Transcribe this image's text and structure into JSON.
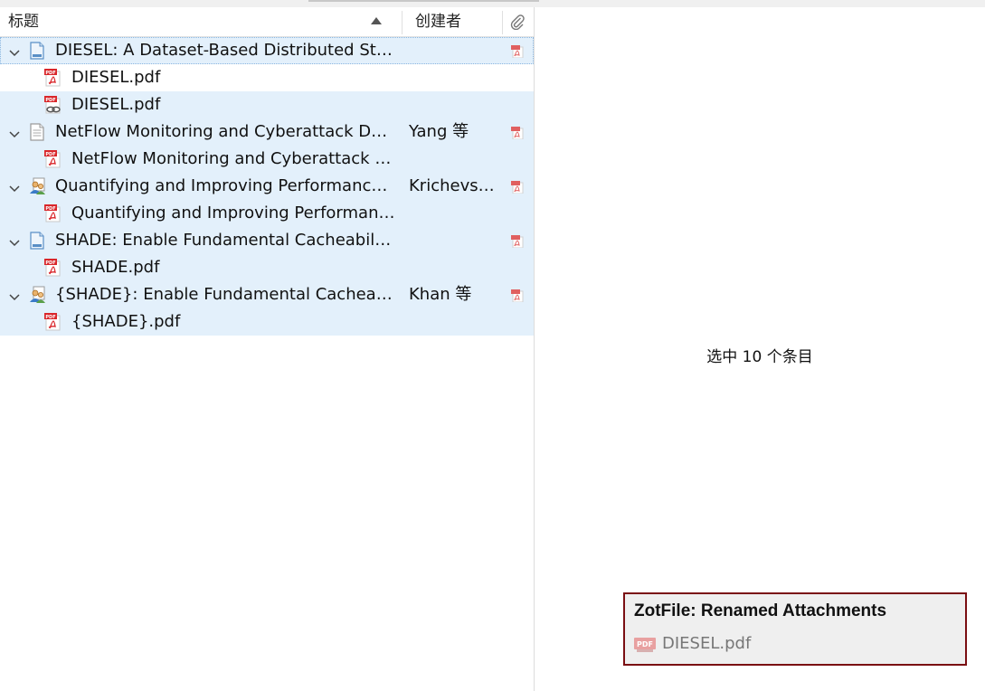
{
  "columns": {
    "title": "标题",
    "creator": "创建者",
    "attachment_icon": "paperclip-icon"
  },
  "items": [
    {
      "kind": "parent",
      "type": "document-icon",
      "title": "DIESEL: A Dataset-Based Distributed Stor…",
      "creator": "",
      "attachment": "pdf-icon"
    },
    {
      "kind": "child",
      "type": "pdf-icon",
      "title": "DIESEL.pdf"
    },
    {
      "kind": "child",
      "type": "linked-pdf-icon",
      "title": "DIESEL.pdf"
    },
    {
      "kind": "parent",
      "type": "note-document-icon",
      "title": "NetFlow Monitoring and Cyberattack Det…",
      "creator": "Yang 等",
      "attachment": "pdf-icon"
    },
    {
      "kind": "child",
      "type": "pdf-icon",
      "title": "NetFlow Monitoring and Cyberattack D…"
    },
    {
      "kind": "parent",
      "type": "conference-paper-icon",
      "title": "Quantifying and Improving Performance …",
      "creator": "Krichevs…",
      "attachment": "pdf-icon"
    },
    {
      "kind": "child",
      "type": "pdf-icon",
      "title": "Quantifying and Improving Performanc…"
    },
    {
      "kind": "parent",
      "type": "document-icon",
      "title": "SHADE: Enable Fundamental Cacheability …",
      "creator": "",
      "attachment": "pdf-icon"
    },
    {
      "kind": "child",
      "type": "pdf-icon",
      "title": "SHADE.pdf"
    },
    {
      "kind": "parent",
      "type": "conference-paper-icon",
      "title": "{SHADE}: Enable Fundamental Cacheabilit…",
      "creator": "Khan 等",
      "attachment": "pdf-icon"
    },
    {
      "kind": "child",
      "type": "pdf-icon",
      "title": "{SHADE}.pdf"
    }
  ],
  "selection_summary": "选中 10 个条目",
  "notification": {
    "title": "ZotFile: Renamed Attachments",
    "file": "DIESEL.pdf",
    "border_color": "#7a0e12"
  },
  "colors": {
    "selection": "#e3f0fb",
    "pdf_red": "#d9262a"
  }
}
